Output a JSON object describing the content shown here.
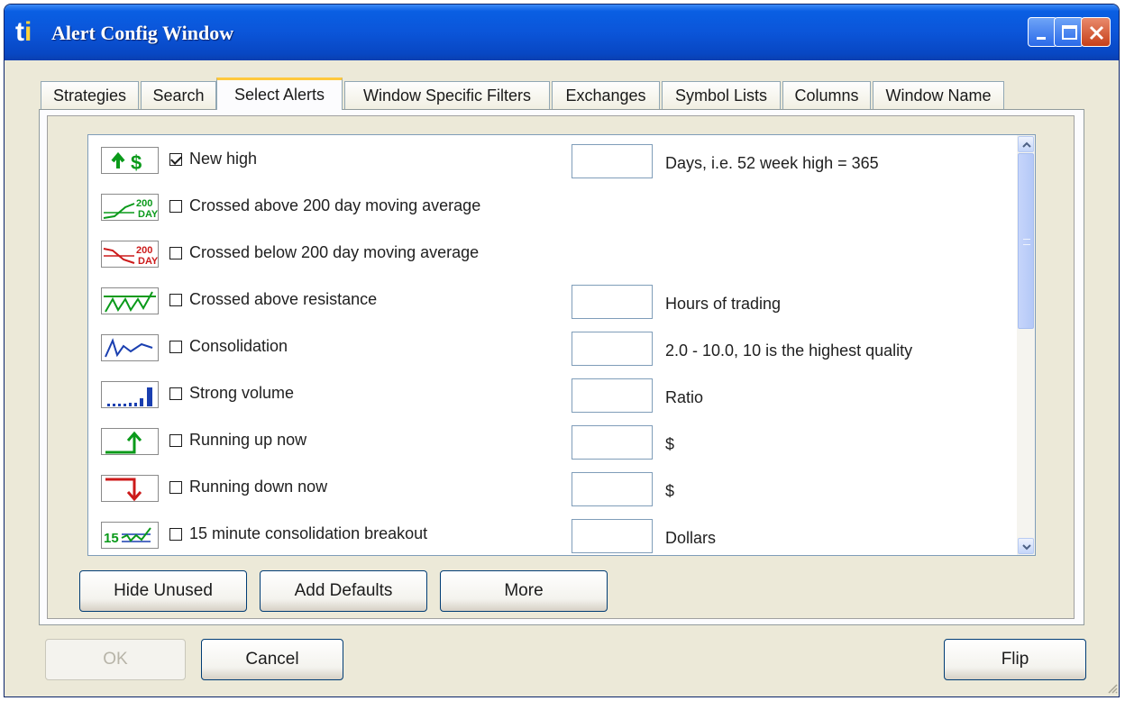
{
  "window": {
    "logo": {
      "t": "t",
      "i": "i"
    },
    "title": "Alert Config Window"
  },
  "tabs": [
    {
      "label": "Strategies",
      "active": false
    },
    {
      "label": "Search",
      "active": false
    },
    {
      "label": "Select Alerts",
      "active": true
    },
    {
      "label": "Window Specific Filters",
      "active": false
    },
    {
      "label": "Exchanges",
      "active": false
    },
    {
      "label": "Symbol Lists",
      "active": false
    },
    {
      "label": "Columns",
      "active": false
    },
    {
      "label": "Window Name",
      "active": false
    }
  ],
  "alerts": [
    {
      "icon": "new-high-icon",
      "checked": true,
      "label": "New high",
      "value": "",
      "unit": "Days, i.e. 52 week high = 365"
    },
    {
      "icon": "crossed-above-200-day-icon",
      "checked": false,
      "label": "Crossed above 200 day moving average",
      "value": null,
      "unit": null
    },
    {
      "icon": "crossed-below-200-day-icon",
      "checked": false,
      "label": "Crossed below 200 day moving average",
      "value": null,
      "unit": null
    },
    {
      "icon": "crossed-above-resistance-icon",
      "checked": false,
      "label": "Crossed above resistance",
      "value": "",
      "unit": "Hours of trading"
    },
    {
      "icon": "consolidation-icon",
      "checked": false,
      "label": "Consolidation",
      "value": "",
      "unit": "2.0 - 10.0, 10 is the highest quality"
    },
    {
      "icon": "strong-volume-icon",
      "checked": false,
      "label": "Strong volume",
      "value": "",
      "unit": "Ratio"
    },
    {
      "icon": "running-up-icon",
      "checked": false,
      "label": "Running up now",
      "value": "",
      "unit": "$"
    },
    {
      "icon": "running-down-icon",
      "checked": false,
      "label": "Running down now",
      "value": "",
      "unit": "$"
    },
    {
      "icon": "15-minute-breakout-icon",
      "checked": false,
      "label": "15 minute consolidation breakout",
      "value": "",
      "unit": "Dollars"
    }
  ],
  "icon_text": {
    "dollar": "$",
    "day200_top": "200",
    "day200_bottom": "DAY",
    "fifteen": "15"
  },
  "panel_buttons": {
    "hide_unused": "Hide Unused",
    "add_defaults": "Add Defaults",
    "more": "More"
  },
  "dialog_buttons": {
    "ok": "OK",
    "cancel": "Cancel",
    "flip": "Flip"
  },
  "colors": {
    "titlebar": "#0b55d9",
    "active_tab_accent": "#ffc83c",
    "window_bg": "#ece9d8"
  }
}
